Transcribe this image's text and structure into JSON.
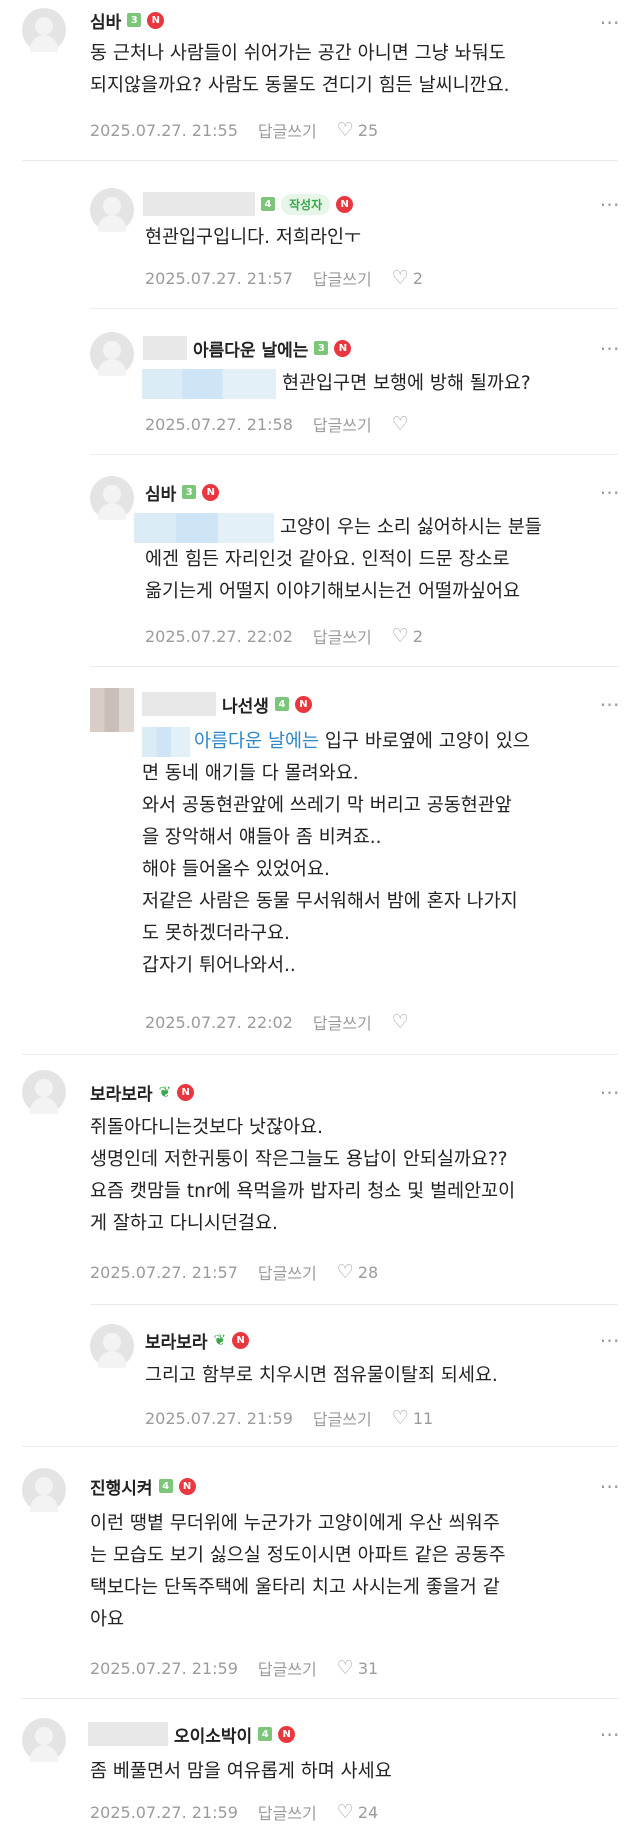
{
  "more_label": "⋯",
  "reply_label": "답글쓰기",
  "writer_label": "작성자",
  "n_badge": "N",
  "comments": [
    {
      "name": "심바",
      "level": "3",
      "text": [
        "동 근처나 사람들이 쉬어가는 공간 아니면 그냥 놔둬도",
        "되지않을까요? 사람도 동물도 견디기 힘든 날씨니깐요."
      ],
      "date": "2025.07.27. 21:55",
      "likes": "25"
    },
    {
      "name": "",
      "level": "4",
      "text": [
        "현관입구입니다. 저희라인ㅜ"
      ],
      "date": "2025.07.27. 21:57",
      "likes": "2"
    },
    {
      "name": "아름다운 날에는",
      "level": "3",
      "text": [
        "현관입구면 보행에 방해 될까요?"
      ],
      "date": "2025.07.27. 21:58",
      "likes": ""
    },
    {
      "name": "심바",
      "level": "3",
      "text": [
        "고양이 우는 소리 싫어하시는 분들",
        "에겐 힘든 자리인것 같아요. 인적이 드문 장소로",
        "옮기는게 어떨지 이야기해보시는건 어떨까싶어요"
      ],
      "date": "2025.07.27. 22:02",
      "likes": "2"
    },
    {
      "name": "나선생",
      "level": "4",
      "mention": "아름다운 날에는",
      "text": [
        "입구 바로옆에 고양이 있으",
        "면 동네 애기들 다 몰려와요.",
        "와서 공동현관앞에 쓰레기 막 버리고 공동현관앞",
        "을 장악해서 얘들아 좀 비켜죠..",
        "해야 들어올수 있었어요.",
        "저같은 사람은 동물 무서워해서 밤에 혼자 나가지",
        "도 못하겠더라구요.",
        "갑자기 튀어나와서.."
      ],
      "date": "2025.07.27. 22:02",
      "likes": ""
    },
    {
      "name": "보라보라",
      "text": [
        "쥐돌아다니는것보다 낫잖아요.",
        "생명인데 저한귀퉁이 작은그늘도 용납이 안되실까요??",
        "요즘 캣맘들 tnr에 욕먹을까 밥자리 청소 및 벌레안꼬이",
        "게 잘하고 다니시던걸요."
      ],
      "date": "2025.07.27. 21:57",
      "likes": "28"
    },
    {
      "name": "보라보라",
      "text": [
        "그리고 함부로 치우시면 점유물이탈죄 되세요."
      ],
      "date": "2025.07.27. 21:59",
      "likes": "11"
    },
    {
      "name": "진행시켜",
      "level": "4",
      "text": [
        "이런 땡볕 무더위에 누군가가 고양이에게 우산 씌워주",
        "는 모습도 보기 싫으실 정도이시면 아파트 같은 공동주",
        "택보다는 단독주택에 울타리 치고 사시는게 좋을거 같",
        "아요"
      ],
      "date": "2025.07.27. 21:59",
      "likes": "31"
    },
    {
      "name": "오이소박이",
      "level": "4",
      "text": [
        "좀 베풀면서 맘을 여유롭게 하며 사세요"
      ],
      "date": "2025.07.27. 21:59",
      "likes": "24"
    }
  ]
}
